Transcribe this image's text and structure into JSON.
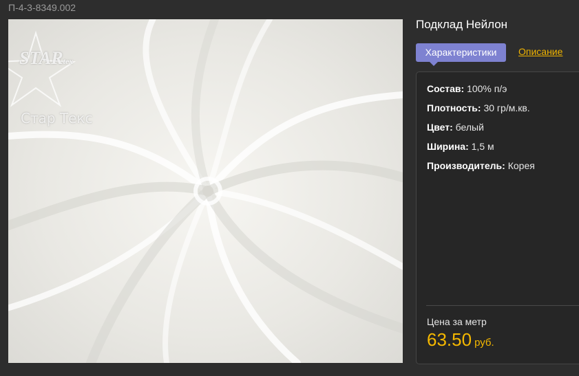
{
  "product": {
    "sku": "П-4-3-8349.002",
    "title": "Подклад Нейлон",
    "image": {
      "brand": "STARtex",
      "brand_main": "STAR",
      "brand_sub": "tex",
      "watermark": "Стар Текс"
    }
  },
  "tabs": {
    "active": "Характеристики",
    "other": "Описание"
  },
  "specs": [
    {
      "label": "Состав:",
      "value": " 100% п/э"
    },
    {
      "label": "Плотность:",
      "value": " 30 гр/м.кв."
    },
    {
      "label": "Цвет:",
      "value": " белый"
    },
    {
      "label": "Ширина:",
      "value": " 1,5 м"
    },
    {
      "label": "Производитель:",
      "value": " Корея"
    }
  ],
  "price": {
    "label": "Цена за метр",
    "value": "63.50",
    "currency": "руб."
  },
  "colors": {
    "accent_tab": "#7e82d1",
    "link": "#f0b400",
    "price": "#f5b800",
    "background": "#2d2d2d"
  }
}
